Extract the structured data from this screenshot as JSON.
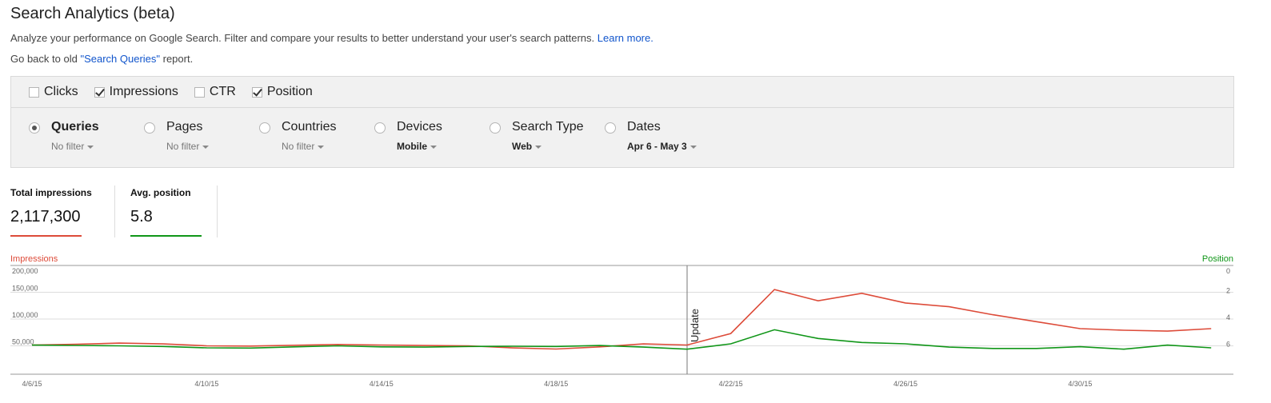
{
  "page": {
    "title": "Search Analytics (beta)",
    "description": "Analyze your performance on Google Search. Filter and compare your results to better understand your user's search patterns.",
    "learn_more": "Learn more.",
    "back_prefix": "Go back to old ",
    "back_link": "\"Search Queries\"",
    "back_suffix": " report."
  },
  "metrics": [
    {
      "label": "Clicks",
      "checked": false
    },
    {
      "label": "Impressions",
      "checked": true
    },
    {
      "label": "CTR",
      "checked": false
    },
    {
      "label": "Position",
      "checked": true
    }
  ],
  "dimensions": [
    {
      "label": "Queries",
      "filter": "No filter",
      "selected": true
    },
    {
      "label": "Pages",
      "filter": "No filter",
      "selected": false
    },
    {
      "label": "Countries",
      "filter": "No filter",
      "selected": false
    },
    {
      "label": "Devices",
      "filter": "Mobile",
      "selected": false
    },
    {
      "label": "Search Type",
      "filter": "Web",
      "selected": false
    },
    {
      "label": "Dates",
      "filter": "Apr 6 - May 3",
      "selected": false
    }
  ],
  "totals": [
    {
      "label": "Total impressions",
      "value": "2,117,300",
      "color": "#dd4b39"
    },
    {
      "label": "Avg. position",
      "value": "5.8",
      "color": "#109618"
    }
  ],
  "chart_data": {
    "type": "line",
    "left_axis_title": "Impressions",
    "right_axis_title": "Position",
    "left_ticks": [
      "200,000",
      "150,000",
      "100,000",
      "50,000"
    ],
    "left_tick_values": [
      200000,
      150000,
      100000,
      50000
    ],
    "right_ticks": [
      "0",
      "2",
      "4",
      "6"
    ],
    "right_tick_values": [
      0,
      2,
      4,
      6
    ],
    "x_tick_labels": [
      "4/6/15",
      "4/10/15",
      "4/14/15",
      "4/18/15",
      "4/22/15",
      "4/26/15",
      "4/30/15"
    ],
    "x": [
      "4/6/15",
      "4/7/15",
      "4/8/15",
      "4/9/15",
      "4/10/15",
      "4/11/15",
      "4/12/15",
      "4/13/15",
      "4/14/15",
      "4/15/15",
      "4/16/15",
      "4/17/15",
      "4/18/15",
      "4/19/15",
      "4/20/15",
      "4/21/15",
      "4/22/15",
      "4/23/15",
      "4/24/15",
      "4/25/15",
      "4/26/15",
      "4/27/15",
      "4/28/15",
      "4/29/15",
      "4/30/15",
      "5/1/15",
      "5/2/15",
      "5/3/15"
    ],
    "annotation": {
      "date": "4/21/15",
      "label": "Update"
    },
    "grid": true,
    "series": [
      {
        "name": "Impressions",
        "axis": "left",
        "color": "#dd4b39",
        "values": [
          51500,
          53000,
          55000,
          53500,
          50000,
          49500,
          51000,
          52500,
          51500,
          50500,
          50000,
          46000,
          44000,
          48000,
          53500,
          51500,
          73000,
          155000,
          134000,
          148000,
          130000,
          123000,
          108000,
          95000,
          82000,
          79000,
          77500,
          82000
        ]
      },
      {
        "name": "Position",
        "axis": "left_scaled",
        "axis_right": "right",
        "color": "#109618",
        "values": [
          5.95,
          5.97,
          6.0,
          6.05,
          6.15,
          6.17,
          6.08,
          6.0,
          6.08,
          6.1,
          6.05,
          6.03,
          6.05,
          5.98,
          6.1,
          6.25,
          5.85,
          4.8,
          5.45,
          5.75,
          5.85,
          6.1,
          6.2,
          6.2,
          6.07,
          6.25,
          5.95,
          6.15
        ]
      }
    ]
  }
}
